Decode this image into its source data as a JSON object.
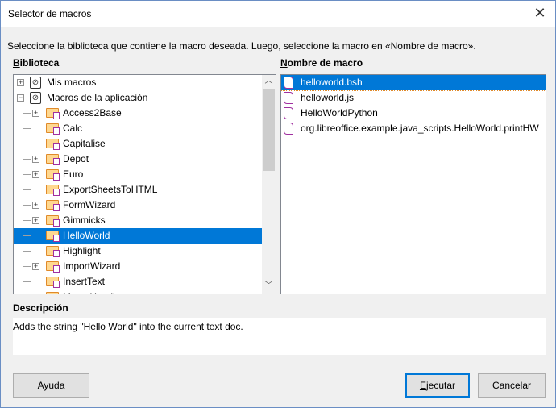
{
  "window": {
    "title": "Selector de macros",
    "close_icon": "close-icon"
  },
  "instruction": "Seleccione la biblioteca que contiene la macro deseada. Luego, seleccione la macro en «Nombre de macro».",
  "library": {
    "label_u": "B",
    "label_rest": "iblioteca",
    "items": [
      {
        "label": "Mis macros",
        "level": 0,
        "expander": "+",
        "icon": "library-icon"
      },
      {
        "label": "Macros de la aplicación",
        "level": 0,
        "expander": "−",
        "icon": "library-icon"
      },
      {
        "label": "Access2Base",
        "level": 1,
        "expander": "+",
        "icon": "folder-icon"
      },
      {
        "label": "Calc",
        "level": 1,
        "expander": "",
        "icon": "folder-icon"
      },
      {
        "label": "Capitalise",
        "level": 1,
        "expander": "",
        "icon": "folder-icon"
      },
      {
        "label": "Depot",
        "level": 1,
        "expander": "+",
        "icon": "folder-icon"
      },
      {
        "label": "Euro",
        "level": 1,
        "expander": "+",
        "icon": "folder-icon"
      },
      {
        "label": "ExportSheetsToHTML",
        "level": 1,
        "expander": "",
        "icon": "folder-icon"
      },
      {
        "label": "FormWizard",
        "level": 1,
        "expander": "+",
        "icon": "folder-icon"
      },
      {
        "label": "Gimmicks",
        "level": 1,
        "expander": "+",
        "icon": "folder-icon"
      },
      {
        "label": "HelloWorld",
        "level": 1,
        "expander": "",
        "icon": "folder-icon",
        "selected": true
      },
      {
        "label": "Highlight",
        "level": 1,
        "expander": "",
        "icon": "folder-icon"
      },
      {
        "label": "ImportWizard",
        "level": 1,
        "expander": "+",
        "icon": "folder-icon"
      },
      {
        "label": "InsertText",
        "level": 1,
        "expander": "",
        "icon": "folder-icon"
      },
      {
        "label": "MacroHandler",
        "level": 1,
        "expander": "",
        "icon": "folder-icon"
      }
    ]
  },
  "macros": {
    "label_u": "N",
    "label_rest": "ombre de macro",
    "items": [
      {
        "label": "helloworld.bsh",
        "selected": true
      },
      {
        "label": "helloworld.js"
      },
      {
        "label": "HelloWorldPython"
      },
      {
        "label": "org.libreoffice.example.java_scripts.HelloWorld.printHW"
      }
    ]
  },
  "description": {
    "label": "Descripción",
    "text": "Adds the string \"Hello World\" into the current text doc."
  },
  "buttons": {
    "help": "Ayuda",
    "run_u": "E",
    "run_rest": "jecutar",
    "cancel": "Cancelar"
  },
  "colors": {
    "selection": "#0078d7"
  }
}
